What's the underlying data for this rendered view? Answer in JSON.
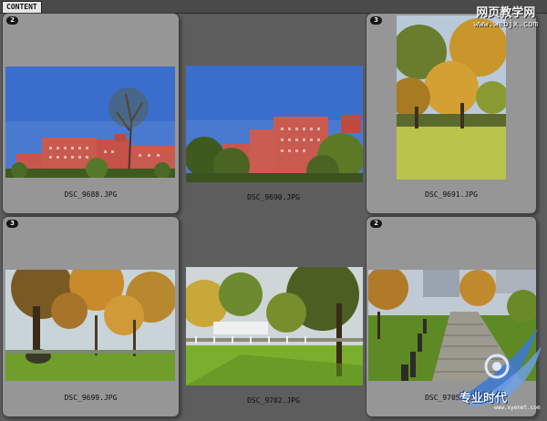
{
  "app": {
    "tab_label": "CONTENT"
  },
  "watermark_top": {
    "text": "网页教学网",
    "url": "www.webjx.com"
  },
  "watermark_bottom": {
    "text": "专业时代",
    "url": "www.xyenet.com"
  },
  "thumbnails": [
    {
      "filename": "DSC_9688.JPG",
      "stack_count": "2"
    },
    {
      "filename": "DSC_9690.JPG",
      "stack_count": ""
    },
    {
      "filename": "DSC_9691.JPG",
      "stack_count": "3"
    },
    {
      "filename": "DSC_9699.JPG",
      "stack_count": "3"
    },
    {
      "filename": "DSC_9702.JPG",
      "stack_count": ""
    },
    {
      "filename": "DSC_9705.JPG",
      "stack_count": "2"
    }
  ],
  "colors": {
    "panel_bg": "#5d5d5d",
    "card_bg": "#969696",
    "badge_bg": "#151515",
    "sky": "#3a6ecc",
    "building": "#c9564e",
    "grass": "#7cae2d"
  }
}
